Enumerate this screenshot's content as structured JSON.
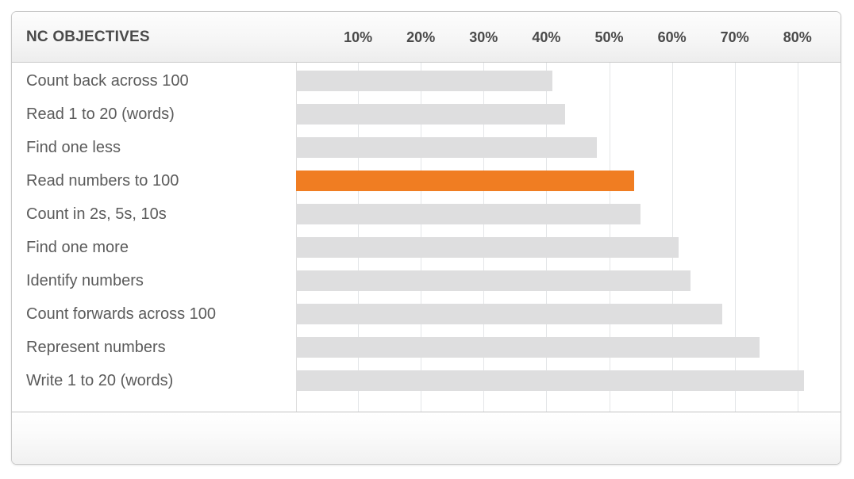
{
  "header": {
    "title": "NC OBJECTIVES"
  },
  "footer": {
    "content": ""
  },
  "chart_data": {
    "type": "bar",
    "orientation": "horizontal",
    "title": "NC OBJECTIVES",
    "xlabel": "",
    "ylabel": "",
    "xlim": [
      0,
      85
    ],
    "grid": true,
    "legend": "none",
    "tick_labels": [
      "10%",
      "20%",
      "30%",
      "40%",
      "50%",
      "60%",
      "70%",
      "80%"
    ],
    "tick_values": [
      10,
      20,
      30,
      40,
      50,
      60,
      70,
      80
    ],
    "categories": [
      "Count back across 100",
      "Read 1 to 20 (words)",
      "Find one less",
      "Read numbers to 100",
      "Count in 2s, 5s, 10s",
      "Find one more",
      "Identify numbers",
      "Count forwards across 100",
      "Represent numbers",
      "Write 1 to 20 (words)"
    ],
    "values": [
      41,
      43,
      48,
      54,
      55,
      61,
      63,
      68,
      74,
      81
    ],
    "highlight_index": 3,
    "colors": {
      "bar": "#dededf",
      "bar_highlight": "#f07d22",
      "gridline": "#e3e5e7",
      "label_text": "#5b5b5b",
      "header_text": "#4a4a4a",
      "panel_border": "#c9c9c9"
    }
  }
}
